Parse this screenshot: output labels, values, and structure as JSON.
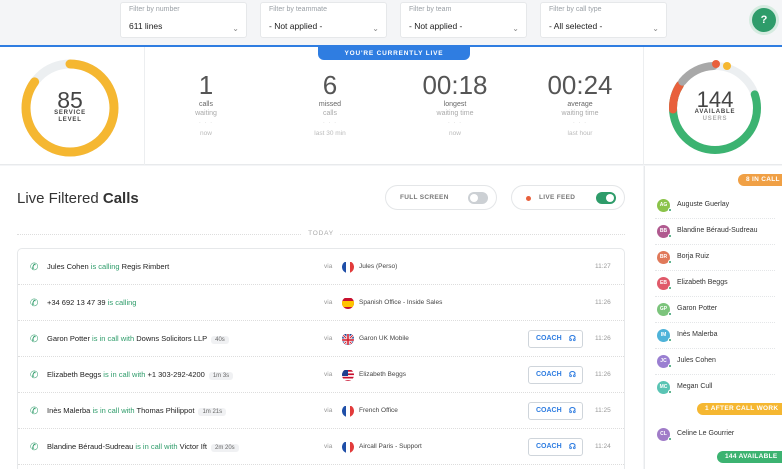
{
  "filters": [
    {
      "label": "Filter by number",
      "value": "611 lines"
    },
    {
      "label": "Filter by teammate",
      "value": "- Not applied -"
    },
    {
      "label": "Filter by team",
      "value": "- Not applied -"
    },
    {
      "label": "Filter by call type",
      "value": "- All selected -"
    }
  ],
  "live_banner": "YOU'RE CURRENTLY LIVE",
  "service_level": {
    "value": "85",
    "label1": "SERVICE",
    "label2": "LEVEL",
    "progress": 0.85,
    "color": "#f5b731"
  },
  "stats": [
    {
      "value": "1",
      "label1": "calls",
      "label2": "waiting",
      "footer": "now"
    },
    {
      "value": "6",
      "label1": "missed",
      "label2": "calls",
      "footer": "last 30 min"
    },
    {
      "value": "00:18",
      "label1": "longest",
      "label2": "waiting time",
      "footer": "now"
    },
    {
      "value": "00:24",
      "label1": "average",
      "label2": "waiting time",
      "footer": "last hour"
    }
  ],
  "available_users": {
    "value": "144",
    "label1": "AVAILABLE",
    "label2": "USERS"
  },
  "panel": {
    "title_light": "Live Filtered ",
    "title_bold": "Calls",
    "full_screen_label": "FULL SCREEN",
    "full_screen_on": false,
    "live_feed_label": "LIVE FEED",
    "live_feed_on": true,
    "day_label": "TODAY"
  },
  "calls": [
    {
      "caller": "Jules Cohen",
      "status": "is calling",
      "target": "Regis Rimbert",
      "duration": "",
      "via": "via",
      "flag": "fr",
      "line": "Jules (Perso)",
      "coach": "",
      "time": "11:27"
    },
    {
      "caller": "+34 692 13 47 39",
      "status": "is calling",
      "target": "",
      "duration": "",
      "via": "via",
      "flag": "es",
      "line": "Spanish Office - Inside Sales",
      "coach": "",
      "time": "11:26"
    },
    {
      "caller": "Garon Potter",
      "status": "is in call with",
      "target": "Downs Solicitors LLP",
      "duration": "40s",
      "via": "via",
      "flag": "uk",
      "line": "Garon UK Mobile",
      "coach": "COACH",
      "time": "11:26"
    },
    {
      "caller": "Elizabeth Beggs",
      "status": "is in call with",
      "target": "+1 303-292-4200",
      "duration": "1m 3s",
      "via": "via",
      "flag": "us",
      "line": "Elizabeth Beggs",
      "coach": "COACH",
      "time": "11:26"
    },
    {
      "caller": "Inès Malerba",
      "status": "is in call with",
      "target": "Thomas Philippot",
      "duration": "1m 21s",
      "via": "via",
      "flag": "fr",
      "line": "French Office",
      "coach": "COACH",
      "time": "11:25"
    },
    {
      "caller": "Blandine Béraud-Sudreau",
      "status": "is in call with",
      "target": "Victor Ift",
      "duration": "2m 20s",
      "via": "via",
      "flag": "fr",
      "line": "Aircall Paris - Support",
      "coach": "COACH",
      "time": "11:24"
    }
  ],
  "sidebar": {
    "in_call_badge": "8 IN CALL",
    "after_call_badge": "1 AFTER CALL WORK",
    "available_badge": "144 AVAILABLE",
    "in_call_users": [
      {
        "initials": "AG",
        "name": "Auguste Guerlay",
        "color": "#8bc34a"
      },
      {
        "initials": "BB",
        "name": "Blandine Béraud-Sudreau",
        "color": "#b05a8f"
      },
      {
        "initials": "BR",
        "name": "Borja Ruiz",
        "color": "#e0795a"
      },
      {
        "initials": "EB",
        "name": "Elizabeth Beggs",
        "color": "#e05a6a"
      },
      {
        "initials": "GP",
        "name": "Garon Potter",
        "color": "#7cc47c"
      },
      {
        "initials": "IM",
        "name": "Inès Malerba",
        "color": "#4fb3d9"
      },
      {
        "initials": "JC",
        "name": "Jules Cohen",
        "color": "#9a7fd1"
      },
      {
        "initials": "MC",
        "name": "Megan Cull",
        "color": "#5ac4b4"
      }
    ],
    "after_call_users": [
      {
        "initials": "CL",
        "name": "Celine Le Gourrier",
        "color": "#a07cc8"
      }
    ]
  }
}
